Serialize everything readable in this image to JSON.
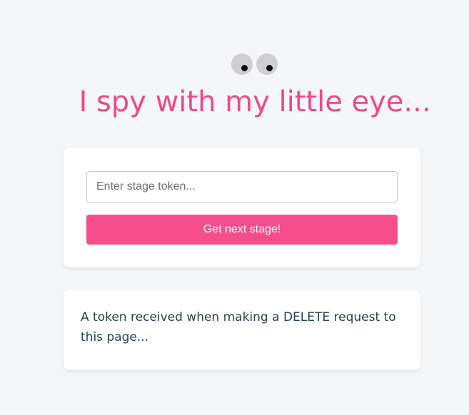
{
  "header": {
    "icon": "googly-eyes",
    "title": "I spy with my little eye..."
  },
  "form": {
    "input_placeholder": "Enter stage token...",
    "input_value": "",
    "button_label": "Get next stage!"
  },
  "hint": {
    "text": "A token received when making a DELETE request to this page..."
  },
  "colors": {
    "accent": "#f54e8b",
    "title": "#ee4a87",
    "background": "#f4f6fa",
    "text": "#2c3e50"
  }
}
